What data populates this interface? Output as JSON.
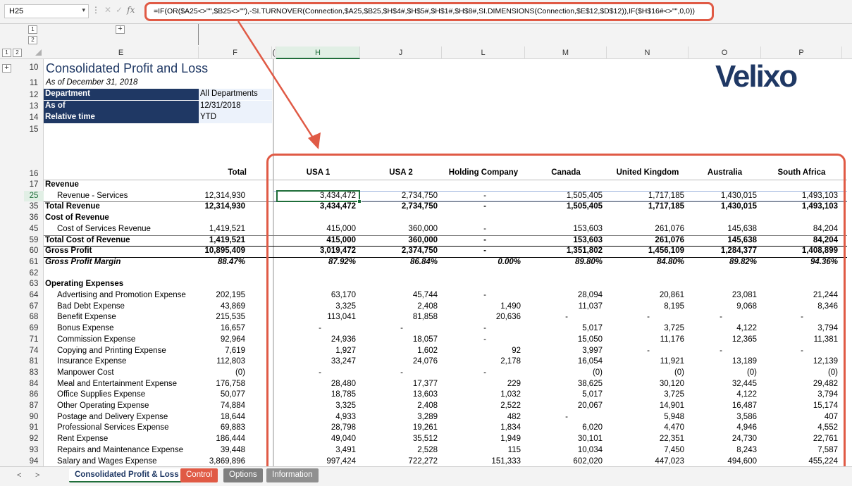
{
  "formula_bar": {
    "name_box": "H25",
    "fx": "fx",
    "formula": "=IF(OR($A25<>\"\",$B25<>\"\"),-SI.TURNOVER(Connection,$A25,$B25,$H$4#,$H$5#,$H$1#,$H$8#,SI.DIMENSIONS(Connection,$E$12,$D$12)),IF($H$16#<>\"\",0,0))"
  },
  "outline": {
    "levels": [
      "1",
      "2"
    ],
    "expand": "+",
    "top_levels": [
      "1",
      "2"
    ]
  },
  "columns": [
    {
      "key": "E",
      "label": "E"
    },
    {
      "key": "F",
      "label": "F"
    },
    {
      "key": "G",
      "label": "("
    },
    {
      "key": "H",
      "label": "H"
    },
    {
      "key": "J",
      "label": "J"
    },
    {
      "key": "L",
      "label": "L"
    },
    {
      "key": "M",
      "label": "M"
    },
    {
      "key": "N",
      "label": "N"
    },
    {
      "key": "O",
      "label": "O"
    },
    {
      "key": "P",
      "label": "P"
    }
  ],
  "sheet": {
    "title": "Consolidated Profit and Loss",
    "subtitle": "As of December 31, 2018",
    "logo": "Velixo",
    "params": [
      {
        "label": "Department",
        "value": "All Departments"
      },
      {
        "label": "As of",
        "value": "12/31/2018"
      },
      {
        "label": "Relative time",
        "value": "YTD"
      }
    ],
    "header_row_number": "16",
    "headers": [
      "Total",
      "USA 1",
      "USA 2",
      "Holding Company",
      "Canada",
      "United Kingdom",
      "Australia",
      "South Africa"
    ],
    "top_rows": [
      "10",
      "11",
      "12",
      "13",
      "14",
      "15"
    ],
    "rows": [
      {
        "n": "17",
        "label": "Revenue",
        "style": "section",
        "values": []
      },
      {
        "n": "25",
        "label": "Revenue - Services",
        "style": "indent",
        "values": [
          "12,314,930",
          "3,434,472",
          "2,734,750",
          "-",
          "1,505,405",
          "1,717,185",
          "1,430,015",
          "1,493,103"
        ]
      },
      {
        "n": "35",
        "label": "Total Revenue",
        "style": "total",
        "values": [
          "12,314,930",
          "3,434,472",
          "2,734,750",
          "-",
          "1,505,405",
          "1,717,185",
          "1,430,015",
          "1,493,103"
        ]
      },
      {
        "n": "36",
        "label": "Cost of Revenue",
        "style": "section",
        "values": []
      },
      {
        "n": "45",
        "label": "Cost of Services Revenue",
        "style": "indent",
        "values": [
          "1,419,521",
          "415,000",
          "360,000",
          "-",
          "153,603",
          "261,076",
          "145,638",
          "84,204"
        ]
      },
      {
        "n": "59",
        "label": "Total Cost of Revenue",
        "style": "total",
        "values": [
          "1,419,521",
          "415,000",
          "360,000",
          "-",
          "153,603",
          "261,076",
          "145,638",
          "84,204"
        ]
      },
      {
        "n": "60",
        "label": "Gross Profit",
        "style": "total",
        "values": [
          "10,895,409",
          "3,019,472",
          "2,374,750",
          "-",
          "1,351,802",
          "1,456,109",
          "1,284,377",
          "1,408,899"
        ]
      },
      {
        "n": "61",
        "label": "Gross Profit Margin",
        "style": "margin",
        "values": [
          "88.47%",
          "87.92%",
          "86.84%",
          "0.00%",
          "89.80%",
          "84.80%",
          "89.82%",
          "94.36%"
        ]
      },
      {
        "n": "62",
        "label": "",
        "style": "blank",
        "values": []
      },
      {
        "n": "63",
        "label": "Operating Expenses",
        "style": "section",
        "values": []
      },
      {
        "n": "64",
        "label": "Advertising and Promotion Expense",
        "style": "indent",
        "values": [
          "202,195",
          "63,170",
          "45,744",
          "-",
          "28,094",
          "20,861",
          "23,081",
          "21,244"
        ]
      },
      {
        "n": "67",
        "label": "Bad Debt Expense",
        "style": "indent",
        "values": [
          "43,869",
          "3,325",
          "2,408",
          "1,490",
          "11,037",
          "8,195",
          "9,068",
          "8,346"
        ]
      },
      {
        "n": "68",
        "label": "Benefit Expense",
        "style": "indent",
        "values": [
          "215,535",
          "113,041",
          "81,858",
          "20,636",
          "-",
          "-",
          "-",
          "-"
        ]
      },
      {
        "n": "69",
        "label": "Bonus Expense",
        "style": "indent",
        "values": [
          "16,657",
          "-",
          "-",
          "-",
          "5,017",
          "3,725",
          "4,122",
          "3,794"
        ]
      },
      {
        "n": "71",
        "label": "Commission Expense",
        "style": "indent",
        "values": [
          "92,964",
          "24,936",
          "18,057",
          "-",
          "15,050",
          "11,176",
          "12,365",
          "11,381"
        ]
      },
      {
        "n": "74",
        "label": "Copying and Printing Expense",
        "style": "indent",
        "values": [
          "7,619",
          "1,927",
          "1,602",
          "92",
          "3,997",
          "-",
          "-",
          "-"
        ]
      },
      {
        "n": "81",
        "label": "Insurance Expense",
        "style": "indent",
        "values": [
          "112,803",
          "33,247",
          "24,076",
          "2,178",
          "16,054",
          "11,921",
          "13,189",
          "12,139"
        ]
      },
      {
        "n": "83",
        "label": "Manpower Cost",
        "style": "indent",
        "values": [
          "(0)",
          "-",
          "-",
          "-",
          "(0)",
          "(0)",
          "(0)",
          "(0)"
        ]
      },
      {
        "n": "84",
        "label": "Meal and Entertainment Expense",
        "style": "indent",
        "values": [
          "176,758",
          "28,480",
          "17,377",
          "229",
          "38,625",
          "30,120",
          "32,445",
          "29,482"
        ]
      },
      {
        "n": "86",
        "label": "Office Supplies Expense",
        "style": "indent",
        "values": [
          "50,077",
          "18,785",
          "13,603",
          "1,032",
          "5,017",
          "3,725",
          "4,122",
          "3,794"
        ]
      },
      {
        "n": "87",
        "label": "Other Operating Expense",
        "style": "indent",
        "values": [
          "74,884",
          "3,325",
          "2,408",
          "2,522",
          "20,067",
          "14,901",
          "16,487",
          "15,174"
        ]
      },
      {
        "n": "90",
        "label": "Postage and Delivery Expense",
        "style": "indent",
        "values": [
          "18,644",
          "4,933",
          "3,289",
          "482",
          "-",
          "5,948",
          "3,586",
          "407"
        ]
      },
      {
        "n": "91",
        "label": "Professional Services Expense",
        "style": "indent",
        "values": [
          "69,883",
          "28,798",
          "19,261",
          "1,834",
          "6,020",
          "4,470",
          "4,946",
          "4,552"
        ]
      },
      {
        "n": "92",
        "label": "Rent Expense",
        "style": "indent",
        "values": [
          "186,444",
          "49,040",
          "35,512",
          "1,949",
          "30,101",
          "22,351",
          "24,730",
          "22,761"
        ]
      },
      {
        "n": "93",
        "label": "Repairs and Maintenance Expense",
        "style": "indent",
        "values": [
          "39,448",
          "3,491",
          "2,528",
          "115",
          "10,034",
          "7,450",
          "8,243",
          "7,587"
        ]
      },
      {
        "n": "94",
        "label": "Salary and Wages Expense",
        "style": "indent",
        "values": [
          "3,869,896",
          "997,424",
          "722,272",
          "151,333",
          "602,020",
          "447,023",
          "494,600",
          "455,224"
        ]
      }
    ]
  },
  "tabs": {
    "nav_prev": "<",
    "nav_next": ">",
    "items": [
      {
        "label": "Consolidated Profit & Loss",
        "style": "active"
      },
      {
        "label": "Control",
        "style": "red"
      },
      {
        "label": "Options",
        "style": "gray"
      },
      {
        "label": "Information",
        "style": "gray"
      }
    ]
  },
  "colors": {
    "accent_red": "#e05a45",
    "navy": "#1f3864",
    "selection_green": "#1f6e3a"
  }
}
